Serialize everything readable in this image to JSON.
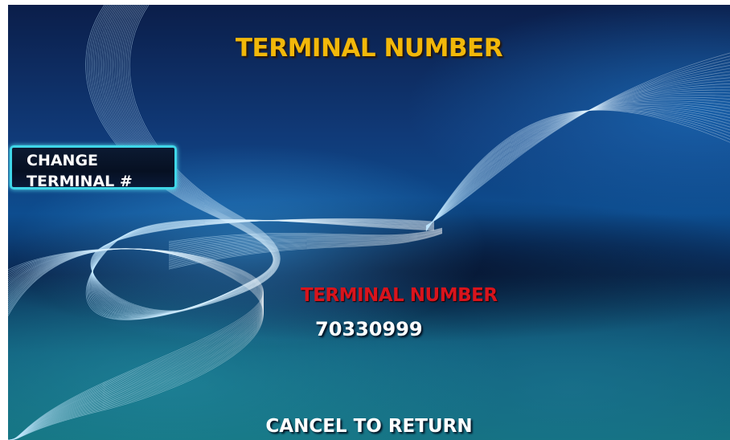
{
  "screen": {
    "title": "TERMINAL NUMBER"
  },
  "buttons": {
    "change_terminal": {
      "line1": "CHANGE",
      "line2": "TERMINAL #"
    }
  },
  "info": {
    "label": "TERMINAL NUMBER",
    "value": "70330999"
  },
  "footer": {
    "cancel_label": "CANCEL TO RETURN"
  },
  "colors": {
    "title": "#f2b80a",
    "label": "#d8141c",
    "button_border": "#3fd6e8",
    "background": "#0d4d8f"
  }
}
